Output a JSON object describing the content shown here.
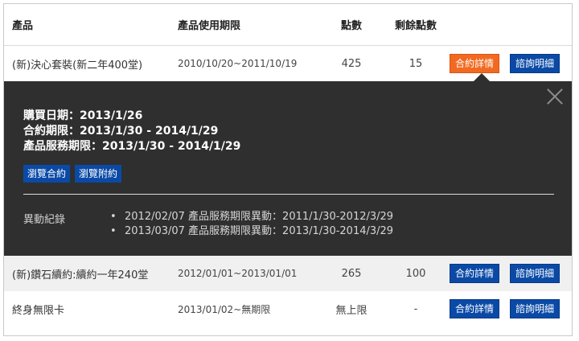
{
  "header": {
    "product": "產品",
    "period": "產品使用期限",
    "points": "點數",
    "remaining": "剩餘點數"
  },
  "rows": [
    {
      "product": "(新)決心套裝(新二年400堂)",
      "period": "2010/10/20~2011/10/19",
      "points": "425",
      "remaining": "15",
      "contract_btn": "合約詳情",
      "detail_btn": "諮詢明細"
    },
    {
      "product": "(新)鑽石續約:續約一年240堂",
      "period": "2012/01/01~2013/01/01",
      "points": "265",
      "remaining": "100",
      "contract_btn": "合約詳情",
      "detail_btn": "諮詢明細"
    },
    {
      "product": "終身無限卡",
      "period": "2013/01/02~無期限",
      "points": "無上限",
      "remaining": "-",
      "contract_btn": "合約詳情",
      "detail_btn": "諮詢明細"
    }
  ],
  "detail": {
    "purchase_date": "購買日期：2013/1/26",
    "contract_period": "合約期限：2013/1/30 - 2014/1/29",
    "service_period": "產品服務期限：2013/1/30 - 2014/1/29",
    "view_contract": "瀏覽合約",
    "view_appendix": "瀏覽附約",
    "log_label": "異動紀錄",
    "log": [
      "2012/02/07 產品服務期限異動：2011/1/30-2012/3/29",
      "2013/03/07 產品服務期限異動：2013/1/30-2014/3/29"
    ]
  },
  "colors": {
    "primary_button": "#0a4aa6",
    "active_button": "#f26a21",
    "detail_panel": "#2f2f2f"
  }
}
